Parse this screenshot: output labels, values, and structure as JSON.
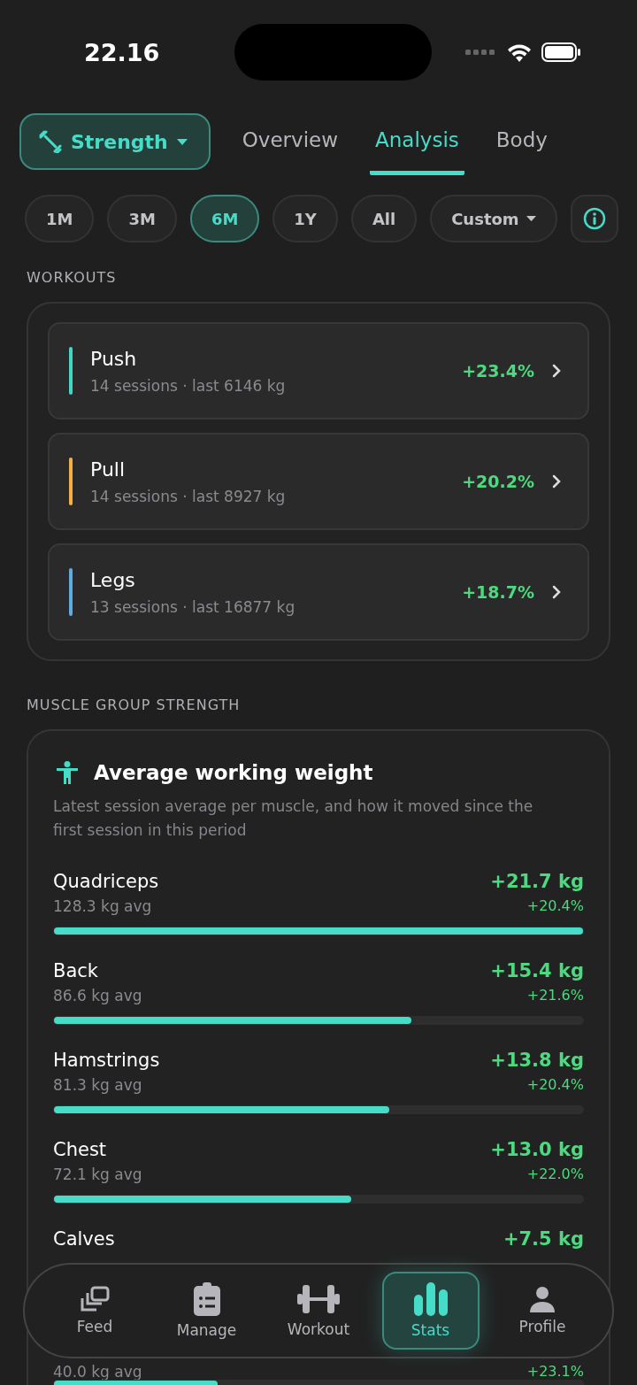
{
  "status_bar": {
    "time": "22.16"
  },
  "mode_button": {
    "label": "Strength"
  },
  "tabs": [
    {
      "label": "Overview",
      "selected": false
    },
    {
      "label": "Analysis",
      "selected": true
    },
    {
      "label": "Body",
      "selected": false
    }
  ],
  "ranges": [
    {
      "label": "1M",
      "selected": false,
      "kind": "chip"
    },
    {
      "label": "3M",
      "selected": false,
      "kind": "chip"
    },
    {
      "label": "6M",
      "selected": true,
      "kind": "chip"
    },
    {
      "label": "1Y",
      "selected": false,
      "kind": "chip"
    },
    {
      "label": "All",
      "selected": false,
      "kind": "chip"
    },
    {
      "label": "Custom",
      "selected": false,
      "kind": "dropdown"
    }
  ],
  "workouts": {
    "heading": "WORKOUTS",
    "items": [
      {
        "name": "Push",
        "detail": "14 sessions · last 6146 kg",
        "change": "+23.4%",
        "color": "#3fd9c6"
      },
      {
        "name": "Pull",
        "detail": "14 sessions · last 8927 kg",
        "change": "+20.2%",
        "color": "#f5b041"
      },
      {
        "name": "Legs",
        "detail": "13 sessions · last 16877 kg",
        "change": "+18.7%",
        "color": "#5dade2"
      }
    ]
  },
  "muscles": {
    "heading": "MUSCLE GROUP STRENGTH",
    "title": "Average working weight",
    "description": "Latest session average per muscle, and how it moved since the first session in this period",
    "items": [
      {
        "name": "Quadriceps",
        "average": "128.3 kg avg",
        "change": "+21.7 kg",
        "percent": "+20.4%",
        "level": 1.0
      },
      {
        "name": "Back",
        "average": "86.6 kg avg",
        "change": "+15.4 kg",
        "percent": "+21.6%",
        "level": 0.675
      },
      {
        "name": "Hamstrings",
        "average": "81.3 kg avg",
        "change": "+13.8 kg",
        "percent": "+20.4%",
        "level": 0.633
      },
      {
        "name": "Chest",
        "average": "72.1 kg avg",
        "change": "+13.0 kg",
        "percent": "+22.0%",
        "level": 0.562
      },
      {
        "name": "Calves",
        "average": "40.0 kg avg",
        "change": "+7.5 kg",
        "percent": "+23.1%",
        "level": 0.31
      }
    ]
  },
  "nav": [
    {
      "label": "Feed",
      "kind": "feed",
      "selected": false
    },
    {
      "label": "Manage",
      "kind": "manage",
      "selected": false
    },
    {
      "label": "Workout",
      "kind": "workout",
      "selected": false
    },
    {
      "label": "Stats",
      "kind": "stats",
      "selected": true
    },
    {
      "label": "Profile",
      "kind": "profile",
      "selected": false
    }
  ]
}
